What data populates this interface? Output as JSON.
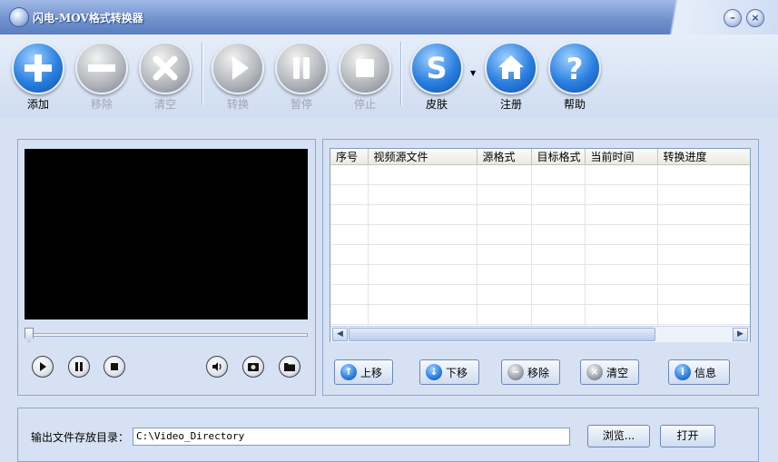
{
  "window": {
    "title": "闪电-MOV格式转换器"
  },
  "toolbar": {
    "add": "添加",
    "remove": "移除",
    "clear": "清空",
    "convert": "转换",
    "pause": "暂停",
    "stop": "停止",
    "skin": "皮肤",
    "register": "注册",
    "help": "帮助"
  },
  "table": {
    "columns": [
      "序号",
      "视频源文件",
      "源格式",
      "目标格式",
      "当前时间",
      "转换进度"
    ],
    "rows": []
  },
  "list_buttons": {
    "up": "上移",
    "down": "下移",
    "remove": "移除",
    "clear": "清空",
    "info": "信息"
  },
  "output": {
    "label": "输出文件存放目录：",
    "path": "C:\\Video_Directory",
    "browse": "浏览...",
    "open": "打开"
  }
}
